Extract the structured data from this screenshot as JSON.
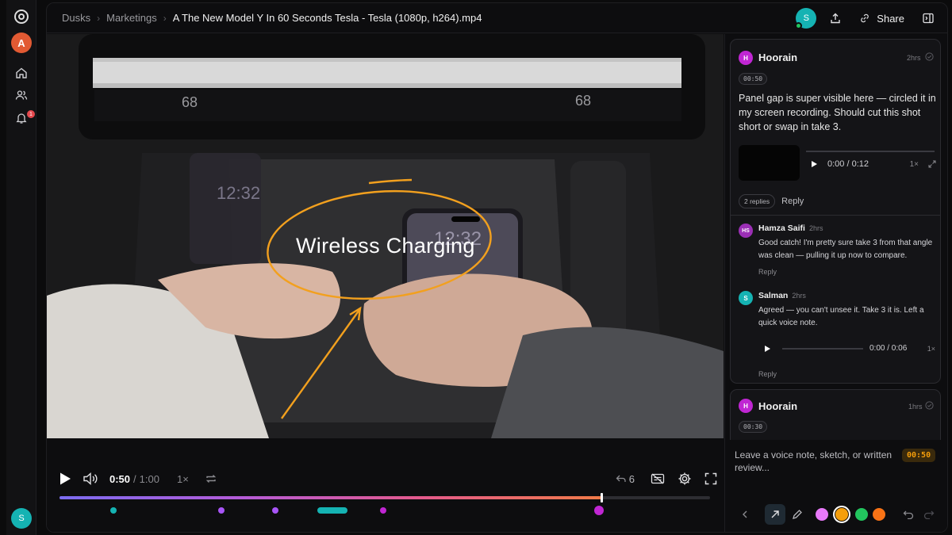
{
  "nav": {
    "workspace_avatar": "A",
    "notification_count": "1",
    "user_avatar": "S"
  },
  "breadcrumb": {
    "items": [
      "Dusks",
      "Marketings"
    ],
    "current": "A The New Model Y In 60 Seconds Tesla - Tesla (1080p, h264).mp4"
  },
  "topbar": {
    "presence_avatar": "S",
    "share_label": "Share"
  },
  "video": {
    "overlay_text": "Wireless Charging",
    "screen_numbers": [
      "68",
      "68"
    ],
    "phone_clock": [
      "12:32",
      "12:32"
    ]
  },
  "player": {
    "current_time": "0:50",
    "separator": "/",
    "total_time": "1:00",
    "speed": "1×",
    "reply_count": "6",
    "progress": 0.833
  },
  "colors": {
    "accent": "#f59e0b",
    "teal": "#15b3b3",
    "magenta": "#c026d3",
    "purple": "#a855f7"
  },
  "comments": [
    {
      "avatar": "H",
      "author": "Hoorain",
      "ago": "2hrs",
      "timestamp": "00:50",
      "text": "Panel gap is super visible here — circled it in my screen recording. Should cut this shot short or swap in take 3.",
      "voice": {
        "time": "0:00 / 0:12",
        "speed": "1×"
      },
      "replies_label": "2 replies",
      "reply_label": "Reply",
      "replies": [
        {
          "avatar": "HS",
          "author": "Hamza Saifi",
          "ago": "2hrs",
          "text": "Good catch! I'm pretty sure take 3 from that angle was clean — pulling it up now to compare.",
          "reply_label": "Reply"
        },
        {
          "avatar": "S",
          "author": "Salman",
          "ago": "2hrs",
          "text": "Agreed — you can't unsee it. Take 3 it is. Left a quick voice note.",
          "voice": {
            "time": "0:00 / 0:06",
            "speed": "1×"
          },
          "reply_label": "Reply"
        }
      ]
    },
    {
      "avatar": "H",
      "author": "Hoorain",
      "ago": "1hrs",
      "timestamp": "00:30"
    }
  ],
  "composer": {
    "placeholder": "Leave a voice note, sketch, or written review...",
    "timestamp": "00:50",
    "swatches": [
      "#e879f9",
      "#f59e0b",
      "#22c55e",
      "#f97316"
    ]
  }
}
